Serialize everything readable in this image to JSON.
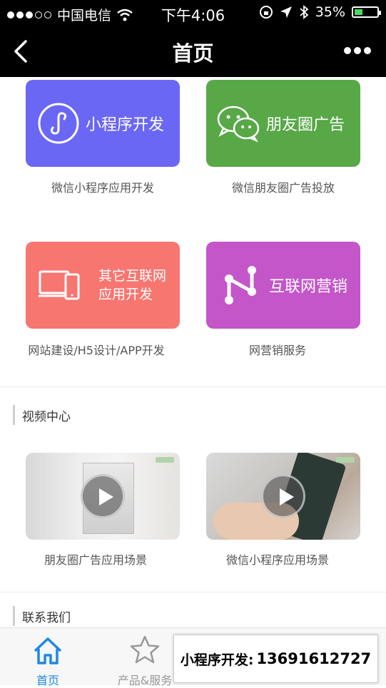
{
  "status_bar": {
    "carrier": "中国电信",
    "time": "下午4:06",
    "battery": "35%",
    "battery_level": 0.35
  },
  "nav": {
    "title": "首页"
  },
  "services": [
    {
      "card_label": "小程序开发",
      "caption": "微信小程序应用开发",
      "color": "#6b67f5",
      "icon": "mini-program-icon"
    },
    {
      "card_label": "朋友圈广告",
      "caption": "微信朋友圈广告投放",
      "color": "#58a848",
      "icon": "wechat-icon"
    },
    {
      "card_label_line1": "其它互联网",
      "card_label_line2": "应用开发",
      "caption": "网站建设/H5设计/APP开发",
      "color": "#f77670",
      "icon": "devices-icon"
    },
    {
      "card_label": "互联网营销",
      "caption": "网营销服务",
      "color": "#c456c9",
      "icon": "network-nodes-icon"
    }
  ],
  "video_section": {
    "title": "视频中心",
    "videos": [
      {
        "caption": "朋友圈广告应用场景",
        "icon": "play-icon"
      },
      {
        "caption": "微信小程序应用场景",
        "icon": "play-icon"
      }
    ]
  },
  "contact_section": {
    "title": "联系我们"
  },
  "tabs": [
    {
      "label": "首页",
      "icon": "home-icon",
      "active": true
    },
    {
      "label": "产品&服务",
      "icon": "star-icon",
      "active": false
    }
  ],
  "hotline": {
    "label": "小程序开发:",
    "phone": "13691612727"
  },
  "colors": {
    "accent": "#1e88e5"
  }
}
